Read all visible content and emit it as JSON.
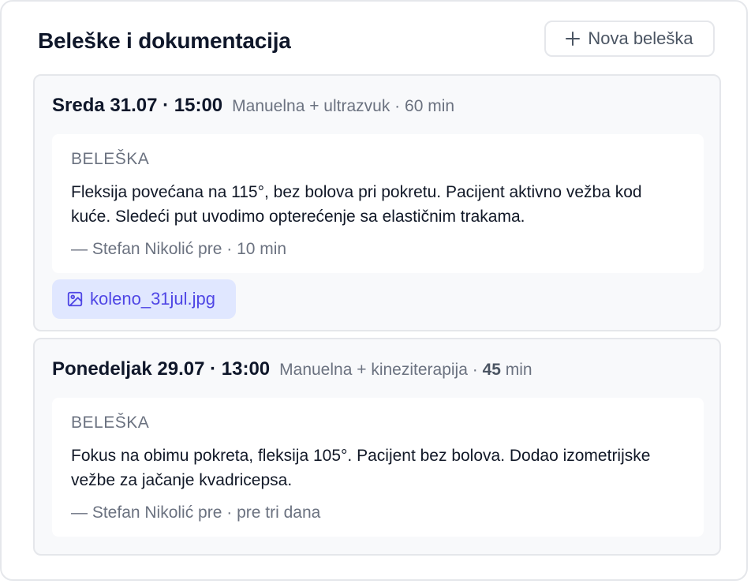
{
  "header": {
    "title": "Beleške i dokumentacija",
    "new_note_label": "Nova beleška"
  },
  "sessions": [
    {
      "date": "Sreda 31.07 · 15:00",
      "type": "Manuelna + ultrazvuk",
      "duration_prefix": " · ",
      "duration_value": "60",
      "duration_unit": " min",
      "note_label": "BELEŠKA",
      "note_text": "Fleksija povećana na 115°, bez bolova pri pokretu. Pacijent aktivno vežba kod kuće. Sledeći put uvodimo opterećenje sa elastičnim trakama.",
      "note_author": "— Stefan Nikolić pre · 10 min",
      "attachment": "koleno_31jul.jpg"
    },
    {
      "date": "Ponedeljak 29.07 · 13:00",
      "type": "Manuelna + kineziterapija",
      "duration_prefix": " · ",
      "duration_value": "45",
      "duration_unit": " min",
      "note_label": "BELEŠKA",
      "note_text": "Fokus na obimu pokreta, fleksija 105°. Pacijent bez bolova. Dodao izometrijske vežbe za jačanje kvadricepsa.",
      "note_author": "— Stefan Nikolić pre · pre tri dana"
    }
  ],
  "colors": {
    "accent": "#4f46e5",
    "attachment_bg": "#e0e7ff",
    "border": "#e5e7eb",
    "muted_text": "#6b7280"
  },
  "icons": {
    "add": "plus-icon",
    "attachment": "image-icon"
  }
}
